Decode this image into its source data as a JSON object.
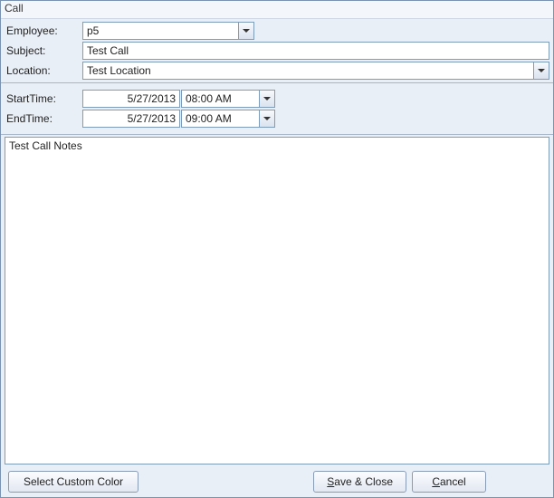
{
  "title": "Call",
  "labels": {
    "employee": "Employee:",
    "subject": "Subject:",
    "location": "Location:",
    "start_time": "StartTime:",
    "end_time": "EndTime:"
  },
  "fields": {
    "employee": "p5",
    "subject": "Test Call",
    "location": "Test Location",
    "start_date": "5/27/2013",
    "start_time": "08:00 AM",
    "end_date": "5/27/2013",
    "end_time": "09:00 AM",
    "notes": "Test Call Notes"
  },
  "buttons": {
    "select_color": "Select Custom Color",
    "save_close_pre": "",
    "save_close_mnemonic": "S",
    "save_close_post": "ave & Close",
    "cancel_pre": "",
    "cancel_mnemonic": "C",
    "cancel_post": "ancel"
  }
}
